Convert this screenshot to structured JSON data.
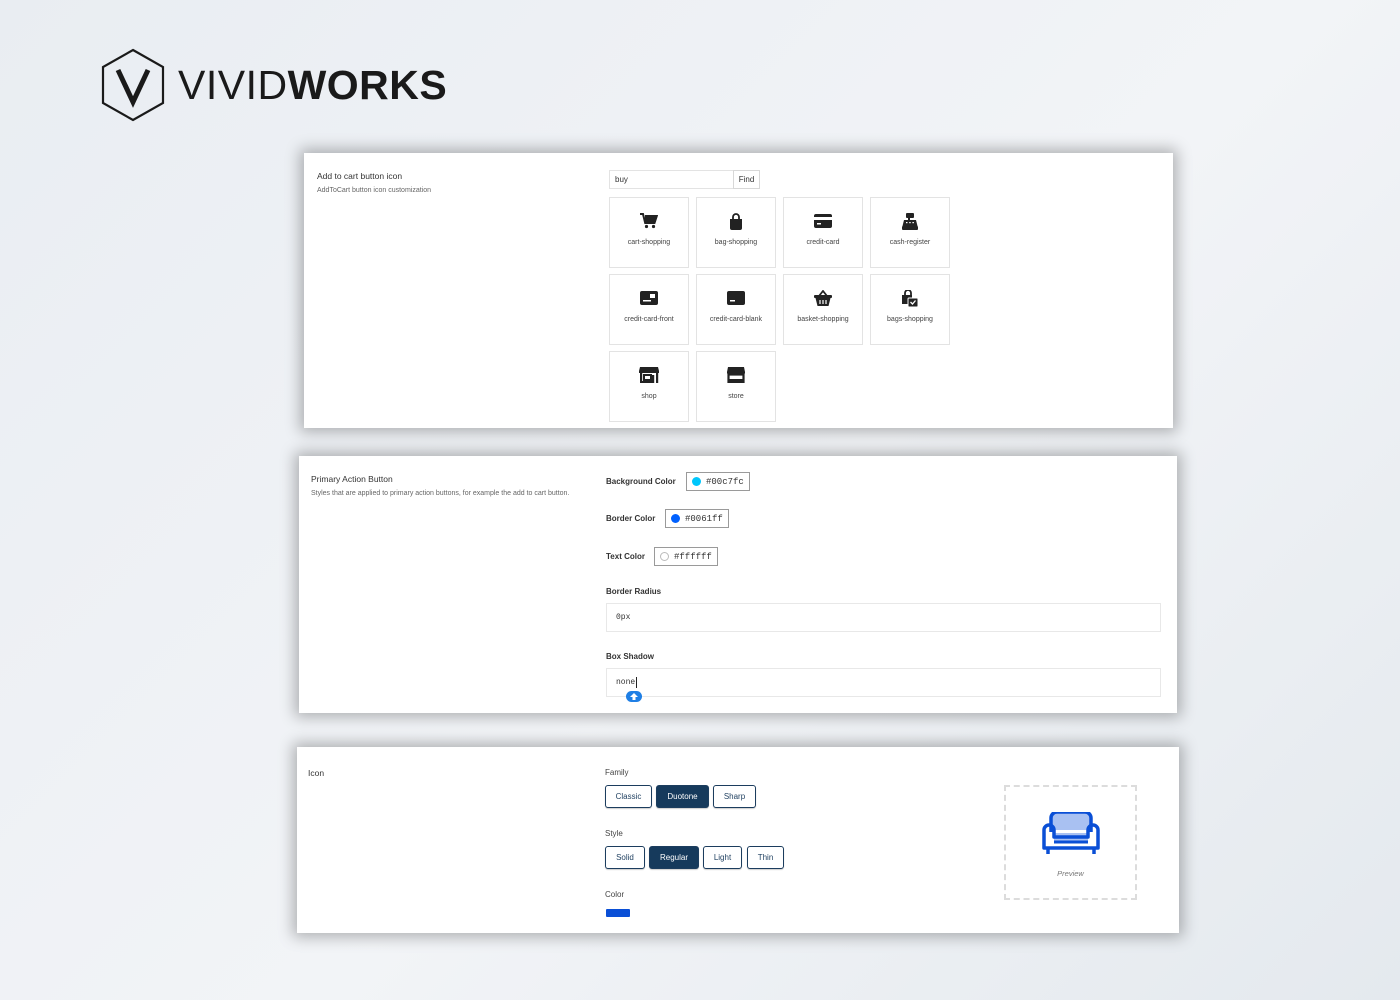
{
  "logo": {
    "light": "VIVID",
    "bold": "WORKS"
  },
  "cart_icon_panel": {
    "title": "Add to cart button icon",
    "description": "AddToCart button icon customization",
    "search_value": "buy",
    "find_label": "Find",
    "icons": [
      {
        "name": "cart-shopping",
        "icon": "cart-icon"
      },
      {
        "name": "bag-shopping",
        "icon": "bag-icon"
      },
      {
        "name": "credit-card",
        "icon": "credit-card-icon"
      },
      {
        "name": "cash-register",
        "icon": "cash-register-icon"
      },
      {
        "name": "credit-card-front",
        "icon": "credit-card-front-icon"
      },
      {
        "name": "credit-card-blank",
        "icon": "credit-card-blank-icon"
      },
      {
        "name": "basket-shopping",
        "icon": "basket-icon"
      },
      {
        "name": "bags-shopping",
        "icon": "bags-icon"
      },
      {
        "name": "shop",
        "icon": "shop-icon"
      },
      {
        "name": "store",
        "icon": "store-icon"
      }
    ]
  },
  "primary_button_panel": {
    "title": "Primary Action Button",
    "description": "Styles that are applied to primary action buttons, for example the add to cart button.",
    "background_color_label": "Background Color",
    "background_color": "#00c7fc",
    "border_color_label": "Border Color",
    "border_color": "#0061ff",
    "text_color_label": "Text Color",
    "text_color": "#ffffff",
    "border_radius_label": "Border Radius",
    "border_radius": "0px",
    "box_shadow_label": "Box Shadow",
    "box_shadow": "none"
  },
  "icon_panel": {
    "title": "Icon",
    "family_label": "Family",
    "family_options": [
      "Classic",
      "Duotone",
      "Sharp"
    ],
    "family_selected": "Duotone",
    "style_label": "Style",
    "style_options": [
      "Solid",
      "Regular",
      "Light",
      "Thin"
    ],
    "style_selected": "Regular",
    "color_label": "Color",
    "color": "#0a4fd6",
    "preview_label": "Preview",
    "preview_icon": "couch-icon"
  }
}
